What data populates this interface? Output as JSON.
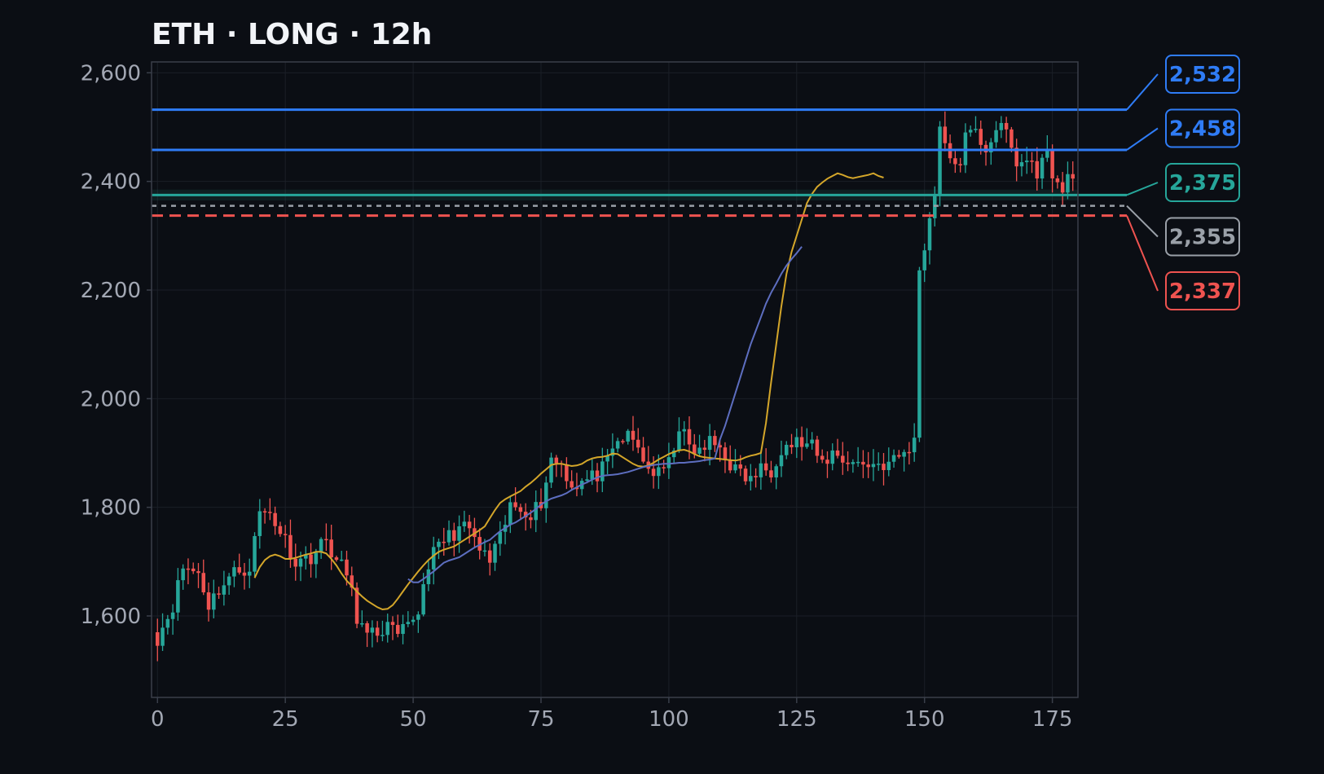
{
  "chart_data": {
    "type": "candlestick",
    "title": "ETH · LONG · 12h",
    "xlabel": "",
    "ylabel": "",
    "xlim": [
      -1,
      180
    ],
    "ylim": [
      1450,
      2620
    ],
    "x_ticks": [
      0,
      25,
      50,
      75,
      100,
      125,
      150,
      175
    ],
    "y_ticks": [
      1600,
      1800,
      2000,
      2200,
      2400,
      2600
    ],
    "x_tick_labels": [
      "0",
      "25",
      "50",
      "75",
      "100",
      "125",
      "150",
      "175"
    ],
    "y_tick_labels": [
      "1,600",
      "1,800",
      "2,000",
      "2,200",
      "2,400",
      "2,600"
    ],
    "grid": true,
    "close_anchors": [
      [
        0,
        1560
      ],
      [
        3,
        1620
      ],
      [
        5,
        1690
      ],
      [
        8,
        1680
      ],
      [
        10,
        1620
      ],
      [
        12,
        1650
      ],
      [
        15,
        1680
      ],
      [
        18,
        1690
      ],
      [
        20,
        1790
      ],
      [
        22,
        1790
      ],
      [
        25,
        1740
      ],
      [
        27,
        1700
      ],
      [
        30,
        1710
      ],
      [
        32,
        1730
      ],
      [
        33,
        1740
      ],
      [
        35,
        1700
      ],
      [
        37,
        1680
      ],
      [
        39,
        1600
      ],
      [
        41,
        1560
      ],
      [
        43,
        1570
      ],
      [
        45,
        1580
      ],
      [
        47,
        1560
      ],
      [
        49,
        1580
      ],
      [
        51,
        1610
      ],
      [
        53,
        1700
      ],
      [
        56,
        1740
      ],
      [
        59,
        1760
      ],
      [
        61,
        1760
      ],
      [
        63,
        1720
      ],
      [
        65,
        1700
      ],
      [
        67,
        1740
      ],
      [
        69,
        1800
      ],
      [
        71,
        1800
      ],
      [
        73,
        1790
      ],
      [
        75,
        1810
      ],
      [
        77,
        1890
      ],
      [
        79,
        1880
      ],
      [
        81,
        1840
      ],
      [
        84,
        1850
      ],
      [
        86,
        1860
      ],
      [
        88,
        1880
      ],
      [
        90,
        1920
      ],
      [
        92,
        1930
      ],
      [
        94,
        1910
      ],
      [
        96,
        1870
      ],
      [
        98,
        1860
      ],
      [
        100,
        1880
      ],
      [
        102,
        1950
      ],
      [
        104,
        1910
      ],
      [
        106,
        1900
      ],
      [
        108,
        1920
      ],
      [
        110,
        1910
      ],
      [
        112,
        1880
      ],
      [
        114,
        1860
      ],
      [
        116,
        1850
      ],
      [
        118,
        1870
      ],
      [
        120,
        1870
      ],
      [
        122,
        1910
      ],
      [
        125,
        1920
      ],
      [
        128,
        1910
      ],
      [
        130,
        1880
      ],
      [
        132,
        1900
      ],
      [
        134,
        1890
      ],
      [
        137,
        1880
      ],
      [
        140,
        1880
      ],
      [
        143,
        1880
      ],
      [
        146,
        1900
      ],
      [
        148,
        1920
      ],
      [
        149,
        2240
      ],
      [
        151,
        2330
      ],
      [
        152,
        2380
      ],
      [
        153,
        2510
      ],
      [
        155,
        2430
      ],
      [
        157,
        2440
      ],
      [
        158,
        2480
      ],
      [
        160,
        2490
      ],
      [
        162,
        2460
      ],
      [
        164,
        2500
      ],
      [
        166,
        2490
      ],
      [
        168,
        2430
      ],
      [
        170,
        2440
      ],
      [
        172,
        2420
      ],
      [
        174,
        2450
      ],
      [
        176,
        2390
      ],
      [
        177,
        2380
      ],
      [
        178,
        2410
      ],
      [
        179,
        2420
      ]
    ],
    "series": [
      {
        "name": "",
        "type": "sma",
        "start": 19,
        "color": "#d4a62a",
        "values": [
          1670,
          1690,
          1703,
          1710,
          1713,
          1710,
          1705,
          1705,
          1707,
          1710,
          1713,
          1715,
          1718,
          1718,
          1715,
          1705,
          1693,
          1678,
          1665,
          1655,
          1645,
          1636,
          1628,
          1622,
          1616,
          1612,
          1613,
          1620,
          1632,
          1645,
          1658,
          1670,
          1682,
          1693,
          1703,
          1711,
          1718,
          1722,
          1725,
          1728,
          1734,
          1740,
          1746,
          1752,
          1758,
          1765,
          1780,
          1795,
          1808,
          1815,
          1820,
          1825,
          1830,
          1838,
          1845,
          1853,
          1862,
          1870,
          1878,
          1880,
          1880,
          1878,
          1876,
          1877,
          1880,
          1886,
          1890,
          1892,
          1893,
          1895,
          1899,
          1898,
          1892,
          1886,
          1880,
          1876,
          1875,
          1877,
          1882,
          1888,
          1893,
          1898,
          1902,
          1905,
          1906,
          1903,
          1898,
          1894,
          1892,
          1891,
          1890,
          1889,
          1888,
          1887,
          1886,
          1888,
          1892,
          1895,
          1897,
          1900,
          1955,
          2030,
          2100,
          2170,
          2230,
          2270,
          2300,
          2330,
          2360,
          2377,
          2390,
          2398,
          2405,
          2410,
          2415,
          2412,
          2408,
          2406,
          2408,
          2410,
          2412,
          2415,
          2410,
          2407
        ]
      },
      {
        "name": "",
        "type": "sma",
        "start": 49,
        "color": "#5d6ec0",
        "values": [
          1668,
          1662,
          1662,
          1668,
          1675,
          1682,
          1690,
          1698,
          1702,
          1705,
          1708,
          1714,
          1720,
          1726,
          1731,
          1736,
          1740,
          1748,
          1756,
          1762,
          1768,
          1772,
          1778,
          1784,
          1790,
          1797,
          1805,
          1811,
          1816,
          1819,
          1822,
          1826,
          1832,
          1837,
          1842,
          1846,
          1851,
          1855,
          1858,
          1859,
          1860,
          1861,
          1863,
          1865,
          1868,
          1871,
          1874,
          1876,
          1878,
          1879,
          1880,
          1880,
          1881,
          1882,
          1882,
          1883,
          1884,
          1885,
          1887,
          1888,
          1890,
          1925,
          1950,
          1980,
          2010,
          2040,
          2070,
          2100,
          2125,
          2150,
          2175,
          2195,
          2212,
          2230,
          2245,
          2257,
          2268,
          2280
        ]
      }
    ],
    "levels": [
      {
        "value": 2532,
        "label": "2,532",
        "color": "#2f7cf6",
        "style": "solid"
      },
      {
        "value": 2458,
        "label": "2,458",
        "color": "#2f7cf6",
        "style": "solid"
      },
      {
        "value": 2375,
        "label": "2,375",
        "color": "#26a69a",
        "style": "solid"
      },
      {
        "value": 2355,
        "label": "2,355",
        "color": "#9aa0a8",
        "style": "dotted"
      },
      {
        "value": 2337,
        "label": "2,337",
        "color": "#ef5350",
        "style": "dashed"
      }
    ],
    "colors": {
      "up": "#26a69a",
      "down": "#ef5350",
      "grid": "#1b1f27",
      "axis": "#3a3f4a",
      "text": "#a3a8b4"
    }
  }
}
